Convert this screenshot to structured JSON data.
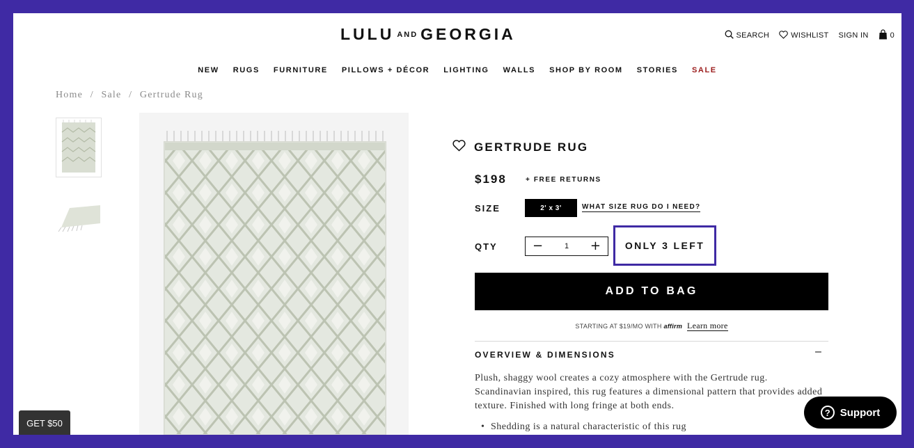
{
  "brand": {
    "logo_left": "LULU",
    "logo_and": "AND",
    "logo_right": "GEORGIA"
  },
  "utility": {
    "search": "SEARCH",
    "wishlist": "WISHLIST",
    "signin": "SIGN IN",
    "cart_count": "0"
  },
  "nav": [
    "NEW",
    "RUGS",
    "FURNITURE",
    "PILLOWS + DÉCOR",
    "LIGHTING",
    "WALLS",
    "SHOP BY ROOM",
    "STORIES",
    "SALE"
  ],
  "breadcrumb": {
    "home": "Home",
    "sep": "/",
    "sale": "Sale",
    "current": "Gertrude Rug"
  },
  "product": {
    "title": "GERTRUDE RUG",
    "price": "$198",
    "free_returns": "+ FREE RETURNS",
    "size_label": "SIZE",
    "size_selected": "2' x 3'",
    "size_guide": "WHAT SIZE RUG DO I NEED?",
    "qty_label": "QTY",
    "qty_value": "1",
    "stock_note": "ONLY 3 LEFT",
    "add_to_bag": "ADD TO BAG",
    "financing_text": "STARTING AT $19/MO WITH",
    "financing_brand": "affirm",
    "learn_more": "Learn more"
  },
  "overview": {
    "title": "OVERVIEW & DIMENSIONS",
    "toggle": "–",
    "description": "Plush, shaggy wool creates a cozy atmosphere with the Gertrude rug. Scandinavian inspired, this rug features a dimensional pattern that provides added texture. Finished with long fringe at both ends.",
    "bullets": [
      "Shedding is a natural characteristic of this rug"
    ]
  },
  "promo": {
    "label": "GET $50"
  },
  "support": {
    "label": "Support"
  },
  "colors": {
    "accent_frame": "#3f2aa4",
    "sale_red": "#9b1c1c",
    "rug_base": "#d9ded2",
    "rug_pattern": "#b3bba6"
  }
}
